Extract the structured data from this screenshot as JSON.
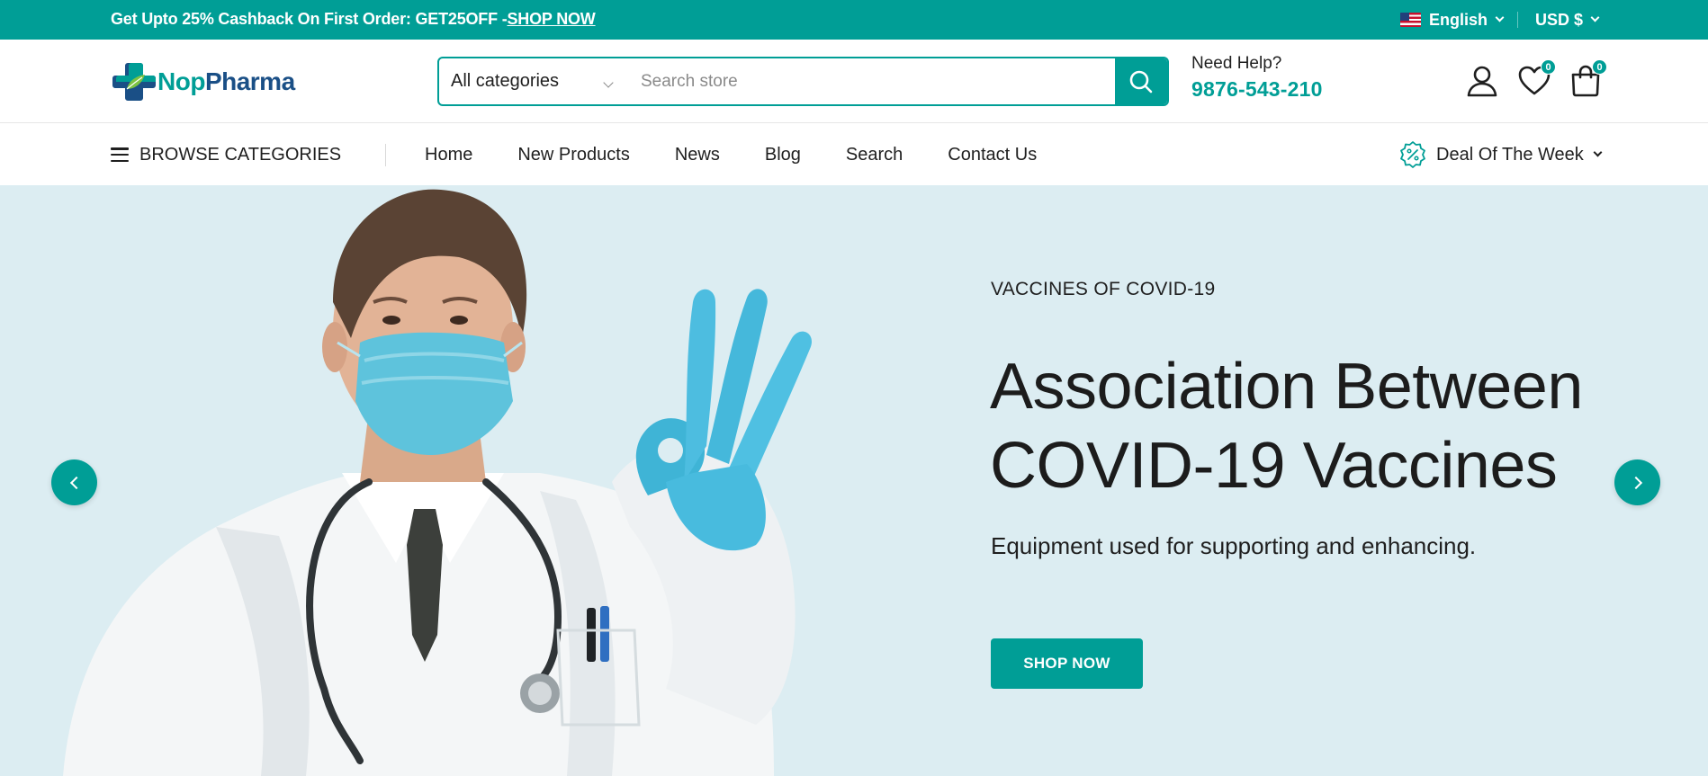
{
  "topbar": {
    "promo_text": "Get Upto 25% Cashback On First Order: GET25OFF -",
    "promo_link": "SHOP NOW",
    "language": "English",
    "currency": "USD $"
  },
  "header": {
    "logo_text_a": "Nop",
    "logo_text_b": "Pharma",
    "search": {
      "category": "All categories",
      "placeholder": "Search store"
    },
    "help_label": "Need Help?",
    "help_phone": "9876-543-210",
    "wishlist_count": "0",
    "cart_count": "0"
  },
  "nav": {
    "browse_label": "BROWSE CATEGORIES",
    "items": [
      "Home",
      "New Products",
      "News",
      "Blog",
      "Search",
      "Contact Us"
    ],
    "deal_label": "Deal Of The Week"
  },
  "hero": {
    "kicker": "VACCINES OF COVID-19",
    "title_line1": "Association Between",
    "title_line2": "COVID-19 Vaccines",
    "subtitle": "Equipment used for supporting and enhancing.",
    "cta": "SHOP NOW"
  },
  "colors": {
    "accent": "#009e96",
    "brand_blue": "#1a4f86",
    "hero_bg": "#dcedf2"
  },
  "icons": [
    "us-flag-icon",
    "chevron-down-icon",
    "search-icon",
    "user-icon",
    "heart-icon",
    "shopping-bag-icon",
    "hamburger-icon",
    "discount-badge-icon",
    "arrow-left-icon",
    "arrow-right-icon"
  ]
}
